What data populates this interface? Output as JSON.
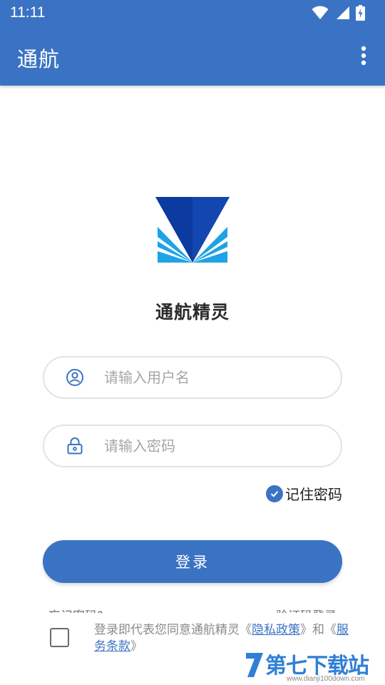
{
  "status_bar": {
    "time": "11:11",
    "icons": [
      "wifi-icon",
      "signal-icon",
      "battery-charging-icon"
    ]
  },
  "app_bar": {
    "title": "通航",
    "menu_icon": "more-vertical-icon"
  },
  "brand": {
    "name": "通航精灵",
    "logo": "app-logo"
  },
  "login_form": {
    "username": {
      "placeholder": "请输入用户名",
      "value": "",
      "icon": "user-circle-icon"
    },
    "password": {
      "placeholder": "请输入密码",
      "value": "",
      "icon": "lock-icon"
    },
    "remember": {
      "label": "记住密码",
      "checked": true
    },
    "submit_label": "登录",
    "forgot_label": "忘记密码?",
    "code_login_label": "验证码登录"
  },
  "agreement": {
    "checked": false,
    "prefix": "登录即代表您同意通航精灵《",
    "privacy_label": "隐私政策",
    "middle": "》和《",
    "terms_label": "服务条款",
    "suffix": "》"
  },
  "watermark": {
    "text": "第七下载站",
    "url": "www.dianji100down.com"
  },
  "colors": {
    "primary": "#3b73c4",
    "logo_dark": "#0b3aa0",
    "logo_light": "#1ea3e6",
    "placeholder": "#a6a6a6"
  }
}
